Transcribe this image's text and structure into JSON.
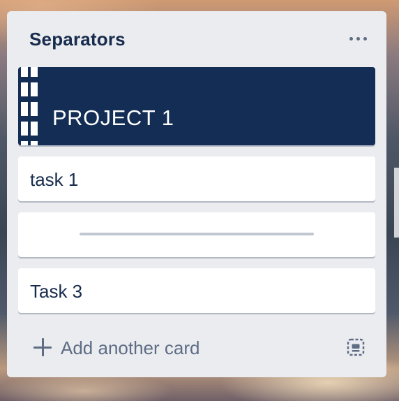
{
  "list": {
    "title": "Separators",
    "menu_icon": "more-horizontal-icon",
    "cards": [
      {
        "kind": "header",
        "text": "PROJECT 1",
        "background": "#132d55",
        "text_color": "#ffffff"
      },
      {
        "kind": "task",
        "text": "task 1"
      },
      {
        "kind": "separator",
        "text": ""
      },
      {
        "kind": "task",
        "text": "Task 3"
      }
    ],
    "composer": {
      "icon": "plus-icon",
      "label": "Add another card",
      "template_icon": "card-template-icon"
    }
  },
  "colors": {
    "list_background": "#ebecf0",
    "card_background": "#ffffff",
    "title_text": "#172b4d",
    "muted_text": "#5e6c84",
    "separator_line": "#c1c7d0"
  }
}
